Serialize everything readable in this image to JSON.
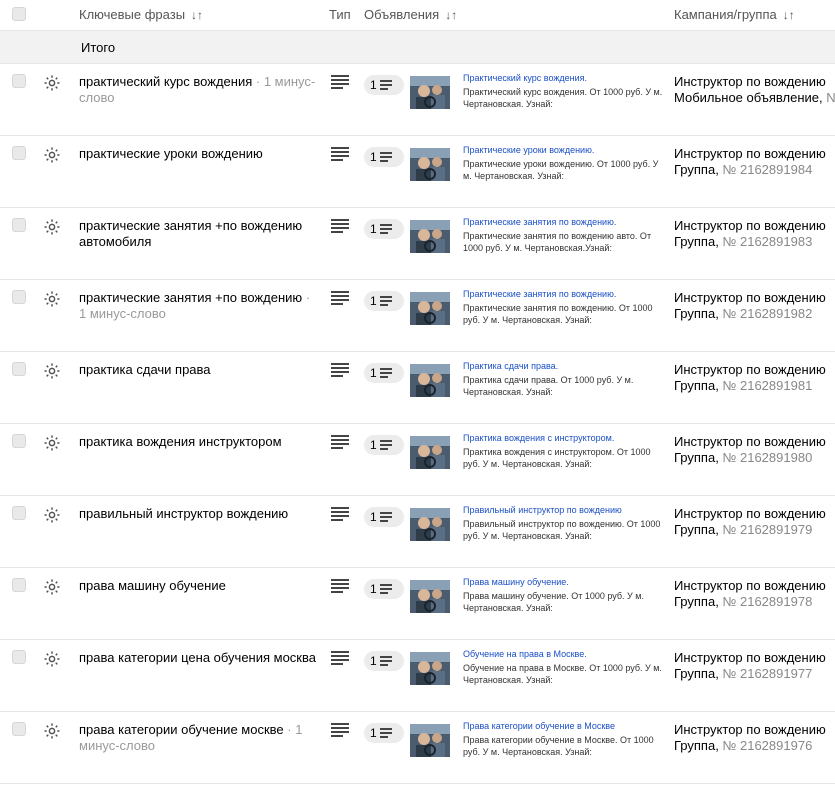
{
  "header": {
    "col_phrases": "Ключевые фразы",
    "col_type": "Тип",
    "col_ads": "Объявления",
    "col_campaign": "Кампания/группа",
    "sort_glyph": "↓↑"
  },
  "total": {
    "label": "Итого"
  },
  "rows": [
    {
      "phrase": "практический курс вождения",
      "minus": "1 минус-слово",
      "ad_count": "1",
      "ad_title": "Практический курс вождения.",
      "ad_text": "Практический курс вождения. От 1000 руб. У м. Чертановская. Узнай:",
      "campaign": "Инструктор по вождению",
      "group_prefix": "Мобильное объявление, ",
      "group_id": "N"
    },
    {
      "phrase": "практические уроки вождению",
      "minus": "",
      "ad_count": "1",
      "ad_title": "Практические уроки вождению.",
      "ad_text": "Практические уроки вождению. От 1000 руб. У м. Чертановская. Узнай:",
      "campaign": "Инструктор по вождению",
      "group_prefix": "Группа, ",
      "group_id": "№ 2162891984"
    },
    {
      "phrase": "практические занятия +по вождению автомобиля",
      "minus": "",
      "ad_count": "1",
      "ad_title": "Практические занятия по вождению.",
      "ad_text": "Практические занятия по вождению авто. От 1000 руб. У м. Чертановская.Узнай:",
      "campaign": "Инструктор по вождению",
      "group_prefix": "Группа, ",
      "group_id": "№ 2162891983"
    },
    {
      "phrase": "практические занятия +по вождению",
      "minus": "1 минус-слово",
      "ad_count": "1",
      "ad_title": "Практические занятия по вождению.",
      "ad_text": "Практические занятия по вождению. От 1000 руб. У м. Чертановская. Узнай:",
      "campaign": "Инструктор по вождению",
      "group_prefix": "Группа, ",
      "group_id": "№ 2162891982"
    },
    {
      "phrase": "практика сдачи права",
      "minus": "",
      "ad_count": "1",
      "ad_title": "Практика сдачи права.",
      "ad_text": "Практика сдачи права. От 1000 руб. У м. Чертановская. Узнай:",
      "campaign": "Инструктор по вождению",
      "group_prefix": "Группа, ",
      "group_id": "№ 2162891981"
    },
    {
      "phrase": "практика вождения инструктором",
      "minus": "",
      "ad_count": "1",
      "ad_title": "Практика вождения с инструктором.",
      "ad_text": "Практика вождения с инструктором. От 1000 руб. У м. Чертановская. Узнай:",
      "campaign": "Инструктор по вождению",
      "group_prefix": "Группа, ",
      "group_id": "№ 2162891980"
    },
    {
      "phrase": "правильный инструктор вождению",
      "minus": "",
      "ad_count": "1",
      "ad_title": "Правильный инструктор по вождению",
      "ad_text": "Правильный инструктор по вождению. От 1000 руб. У м. Чертановская. Узнай:",
      "campaign": "Инструктор по вождению",
      "group_prefix": "Группа, ",
      "group_id": "№ 2162891979"
    },
    {
      "phrase": "права машину обучение",
      "minus": "",
      "ad_count": "1",
      "ad_title": "Права машину обучение.",
      "ad_text": "Права машину обучение. От 1000 руб. У м. Чертановская. Узнай:",
      "campaign": "Инструктор по вождению",
      "group_prefix": "Группа, ",
      "group_id": "№ 2162891978"
    },
    {
      "phrase": "права категории цена обучения москва",
      "minus": "",
      "ad_count": "1",
      "ad_title": "Обучение на права в Москве.",
      "ad_text": "Обучение на права в Москве. От 1000 руб. У м. Чертановская. Узнай:",
      "campaign": "Инструктор по вождению",
      "group_prefix": "Группа, ",
      "group_id": "№ 2162891977"
    },
    {
      "phrase": "права категории обучение москве",
      "minus": "1 минус-слово",
      "ad_count": "1",
      "ad_title": "Права категории обучение в Москве",
      "ad_text": "Права категории обучение в Москве. От 1000 руб. У м. Чертановская. Узнай:",
      "campaign": "Инструктор по вождению",
      "group_prefix": "Группа, ",
      "group_id": "№ 2162891976"
    }
  ],
  "icons": {
    "row_settings": "gear-icon",
    "type": "text-ad-type-icon",
    "ad_count": "ad-list-icon"
  },
  "colors": {
    "ad_title": "#1a4fc6",
    "muted": "#999999",
    "total_bg": "#f2f2f2"
  }
}
